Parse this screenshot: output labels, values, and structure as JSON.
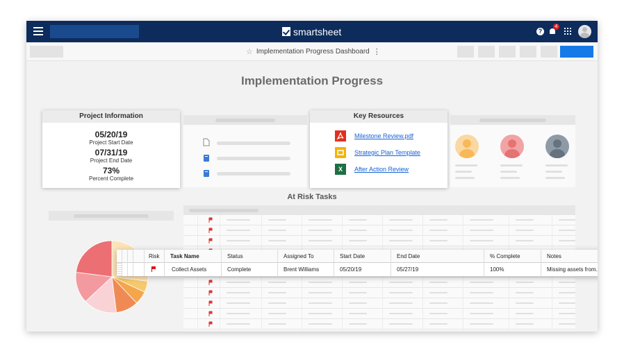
{
  "app": {
    "logo_text": "smartsheet",
    "notification_count": "4",
    "help_glyph": "?"
  },
  "toolbar": {
    "title": "Implementation Progress Dashboard",
    "star_icon": "star-icon",
    "more_glyph": "⋮"
  },
  "dashboard": {
    "title": "Implementation Progress",
    "project_info": {
      "title": "Project Information",
      "items": [
        {
          "value": "05/20/19",
          "label": "Project Start Date"
        },
        {
          "value": "07/31/19",
          "label": "Project End Date"
        },
        {
          "value": "73%",
          "label": "Percent Complete"
        }
      ]
    },
    "key_resources": {
      "title": "Key Resources",
      "items": [
        {
          "label": "Milestone Review.pdf",
          "icon": "pdf-icon",
          "color": "#e0301e"
        },
        {
          "label": "Strategic Plan Template",
          "icon": "slides-icon",
          "color": "#f4b400"
        },
        {
          "label": "After Action Review",
          "icon": "excel-icon",
          "color": "#1d6f42",
          "glyph": "X"
        }
      ]
    },
    "at_risk": {
      "title": "At Risk Tasks",
      "columns": [
        "Risk",
        "Task Name",
        "Status",
        "Assigned To",
        "Start Date",
        "End Date",
        "% Complete",
        "Notes"
      ],
      "rows": [
        {
          "task": "Collect Assets",
          "status": "Complete",
          "assigned": "Brent Williams",
          "start": "05/20/19",
          "end": "05/27/19",
          "complete": "100%",
          "notes": "Missing assets from..."
        }
      ]
    }
  },
  "colors": {
    "navy": "#0d2c5c",
    "primary_button": "#1579e8",
    "link": "#1560d4",
    "risk_flag": "#e01515"
  }
}
